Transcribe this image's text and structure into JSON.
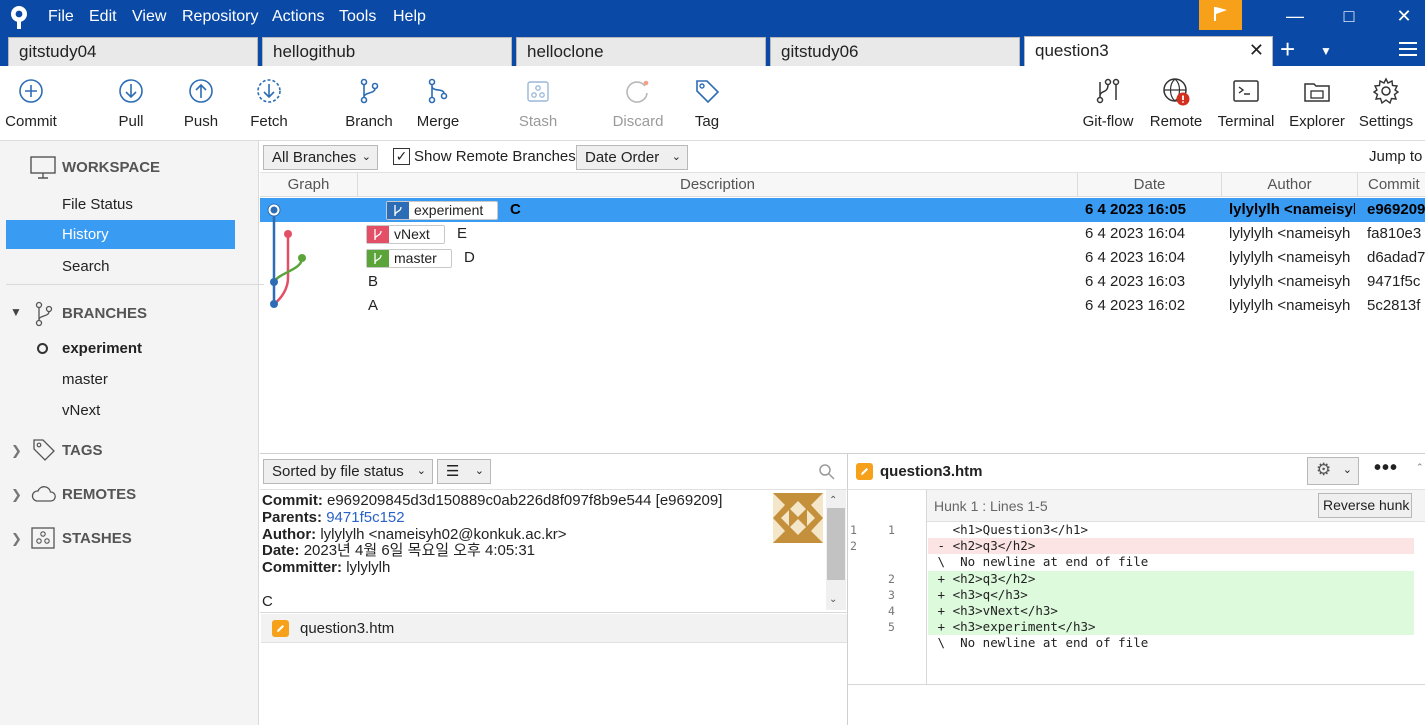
{
  "menu": [
    "File",
    "Edit",
    "View",
    "Repository",
    "Actions",
    "Tools",
    "Help"
  ],
  "tabs": [
    "gitstudy04",
    "hellogithub",
    "helloclone",
    "gitstudy06",
    "question3"
  ],
  "active_tab": "question3",
  "toolbar": {
    "commit": "Commit",
    "pull": "Pull",
    "push": "Push",
    "fetch": "Fetch",
    "branch": "Branch",
    "merge": "Merge",
    "stash": "Stash",
    "discard": "Discard",
    "tag": "Tag",
    "gitflow": "Git-flow",
    "remote": "Remote",
    "terminal": "Terminal",
    "explorer": "Explorer",
    "settings": "Settings"
  },
  "sidebar": {
    "workspace": "WORKSPACE",
    "file_status": "File Status",
    "history": "History",
    "search": "Search",
    "branches": "BRANCHES",
    "branch_items": [
      "experiment",
      "master",
      "vNext"
    ],
    "tags": "TAGS",
    "remotes": "REMOTES",
    "stashes": "STASHES"
  },
  "filters": {
    "branches": "All Branches",
    "show_remote": "Show Remote Branches",
    "order": "Date Order",
    "jump": "Jump to"
  },
  "columns": {
    "graph": "Graph",
    "description": "Description",
    "date": "Date",
    "author": "Author",
    "commit": "Commit"
  },
  "commits": [
    {
      "badge": "experiment",
      "msg": "C",
      "date": "6 4 2023 16:05",
      "author": "lylylylh <nameisyh",
      "hash": "e969209"
    },
    {
      "badge": "vNext",
      "msg": "E",
      "date": "6 4 2023 16:04",
      "author": "lylylylh <nameisyh",
      "hash": "fa810e3"
    },
    {
      "badge": "master",
      "msg": "D",
      "date": "6 4 2023 16:04",
      "author": "lylylylh <nameisyh",
      "hash": "d6adad7"
    },
    {
      "badge": "",
      "msg": "B",
      "date": "6 4 2023 16:03",
      "author": "lylylylh <nameisyh",
      "hash": "9471f5c"
    },
    {
      "badge": "",
      "msg": "A",
      "date": "6 4 2023 16:02",
      "author": "lylylylh <nameisyh",
      "hash": "5c2813f"
    }
  ],
  "detail": {
    "sort": "Sorted by file status",
    "commit_label": "Commit:",
    "commit_value": "e969209845d3d150889c0ab226d8f097f8b9e544 [e969209]",
    "parents_label": "Parents:",
    "parents_value": "9471f5c152",
    "author_label": "Author:",
    "author_value": "lylylylh <nameisyh02@konkuk.ac.kr>",
    "date_label": "Date:",
    "date_value": "2023년 4월 6일 목요일 오후 4:05:31",
    "committer_label": "Committer:",
    "committer_value": "lylylylh",
    "message": "C",
    "file": "question3.htm"
  },
  "diff": {
    "file": "question3.htm",
    "hunk": "Hunk 1 : Lines 1-5",
    "reverse": "Reverse hunk",
    "lines": [
      {
        "old": "1",
        "new": "1",
        "type": "ctx",
        "text": "   <h1>Question3</h1>"
      },
      {
        "old": "2",
        "new": "",
        "type": "del",
        "text": " - <h2>q3</h2>"
      },
      {
        "old": "",
        "new": "",
        "type": "ctx",
        "text": " \\  No newline at end of file"
      },
      {
        "old": "",
        "new": "2",
        "type": "add",
        "text": " + <h2>q3</h2>"
      },
      {
        "old": "",
        "new": "3",
        "type": "add",
        "text": " + <h3>q</h3>"
      },
      {
        "old": "",
        "new": "4",
        "type": "add",
        "text": " + <h3>vNext</h3>"
      },
      {
        "old": "",
        "new": "5",
        "type": "add",
        "text": " + <h3>experiment</h3>"
      },
      {
        "old": "",
        "new": "",
        "type": "ctx",
        "text": " \\  No newline at end of file"
      }
    ]
  },
  "colors": {
    "accent": "#3a9bf2",
    "titlebar": "#0a4aa6",
    "flag": "#f7a11a",
    "experiment": "#2d6db5",
    "vnext": "#e24f66",
    "master": "#5aa43a"
  }
}
